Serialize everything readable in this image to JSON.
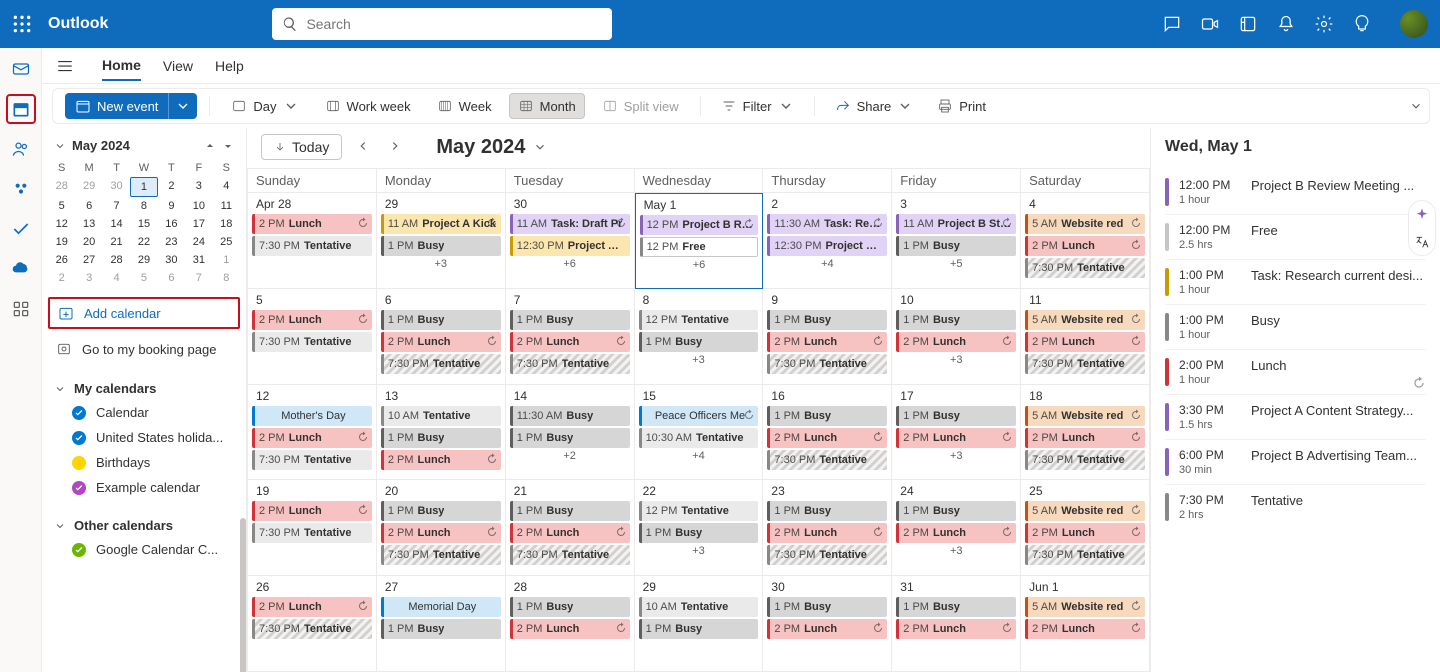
{
  "header": {
    "brand": "Outlook",
    "search_placeholder": "Search"
  },
  "rail": {
    "active": "calendar"
  },
  "menubar": {
    "home": "Home",
    "view": "View",
    "help": "Help"
  },
  "toolbar": {
    "new_event": "New event",
    "day": "Day",
    "work_week": "Work week",
    "week": "Week",
    "month": "Month",
    "split_view": "Split view",
    "filter": "Filter",
    "share": "Share",
    "print": "Print"
  },
  "mini": {
    "title": "May 2024",
    "dow": [
      "S",
      "M",
      "T",
      "W",
      "T",
      "F",
      "S"
    ],
    "cells": [
      {
        "n": "28",
        "o": true
      },
      {
        "n": "29",
        "o": true
      },
      {
        "n": "30",
        "o": true
      },
      {
        "n": "1",
        "today": true
      },
      {
        "n": "2"
      },
      {
        "n": "3"
      },
      {
        "n": "4"
      },
      {
        "n": "5"
      },
      {
        "n": "6"
      },
      {
        "n": "7"
      },
      {
        "n": "8"
      },
      {
        "n": "9"
      },
      {
        "n": "10"
      },
      {
        "n": "11"
      },
      {
        "n": "12"
      },
      {
        "n": "13"
      },
      {
        "n": "14"
      },
      {
        "n": "15"
      },
      {
        "n": "16"
      },
      {
        "n": "17"
      },
      {
        "n": "18"
      },
      {
        "n": "19"
      },
      {
        "n": "20"
      },
      {
        "n": "21"
      },
      {
        "n": "22"
      },
      {
        "n": "23"
      },
      {
        "n": "24"
      },
      {
        "n": "25"
      },
      {
        "n": "26"
      },
      {
        "n": "27"
      },
      {
        "n": "28"
      },
      {
        "n": "29"
      },
      {
        "n": "30"
      },
      {
        "n": "31"
      },
      {
        "n": "1",
        "o": true
      },
      {
        "n": "2",
        "o": true
      },
      {
        "n": "3",
        "o": true
      },
      {
        "n": "4",
        "o": true
      },
      {
        "n": "5",
        "o": true
      },
      {
        "n": "6",
        "o": true
      },
      {
        "n": "7",
        "o": true
      },
      {
        "n": "8",
        "o": true
      }
    ]
  },
  "links": {
    "add_calendar": "Add calendar",
    "booking": "Go to my booking page"
  },
  "groups": {
    "my": {
      "title": "My calendars",
      "items": [
        {
          "name": "Calendar",
          "color": "#0078d4",
          "check": true
        },
        {
          "name": "United States holida...",
          "color": "#0078d4",
          "check": true
        },
        {
          "name": "Birthdays",
          "color": "#ffd400",
          "check": false
        },
        {
          "name": "Example calendar",
          "color": "#b146c2",
          "check": true
        }
      ]
    },
    "other": {
      "title": "Other calendars",
      "items": [
        {
          "name": "Google Calendar C...",
          "color": "#6bb700",
          "check": true
        }
      ]
    }
  },
  "cal": {
    "today_btn": "Today",
    "title": "May 2024",
    "dow": [
      "Sunday",
      "Monday",
      "Tuesday",
      "Wednesday",
      "Thursday",
      "Friday",
      "Saturday"
    ],
    "days": [
      {
        "label": "Apr 28",
        "events": [
          {
            "c": "ev-lunch",
            "t": "2 PM",
            "s": "Lunch",
            "r": true
          },
          {
            "c": "ev-tent",
            "t": "7:30 PM",
            "s": "Tentative"
          }
        ]
      },
      {
        "label": "29",
        "events": [
          {
            "c": "ev-projA",
            "t": "11 AM",
            "s": "Project A Kick",
            "r": true
          },
          {
            "c": "ev-busy",
            "t": "1 PM",
            "s": "Busy"
          }
        ],
        "more": "+3"
      },
      {
        "label": "30",
        "events": [
          {
            "c": "ev-task",
            "t": "11 AM",
            "s": "Task: Draft Pr",
            "r": true
          },
          {
            "c": "ev-projB2",
            "t": "12:30 PM",
            "s": "Project A D"
          }
        ],
        "more": "+6"
      },
      {
        "label": "May 1",
        "today": true,
        "events": [
          {
            "c": "ev-projB",
            "t": "12 PM",
            "s": "Project B Revi",
            "r": true
          },
          {
            "c": "ev-free",
            "t": "12 PM",
            "s": "Free"
          }
        ],
        "more": "+6"
      },
      {
        "label": "2",
        "events": [
          {
            "c": "ev-task",
            "t": "11:30 AM",
            "s": "Task: Revie",
            "r": true
          },
          {
            "c": "ev-projB",
            "t": "12:30 PM",
            "s": "Project B Lo"
          }
        ],
        "more": "+4"
      },
      {
        "label": "3",
        "events": [
          {
            "c": "ev-task",
            "t": "11 AM",
            "s": "Project B Stak",
            "r": true
          },
          {
            "c": "ev-busy",
            "t": "1 PM",
            "s": "Busy"
          }
        ],
        "more": "+5"
      },
      {
        "label": "4",
        "events": [
          {
            "c": "ev-website",
            "t": "5 AM",
            "s": "Website red",
            "r": true
          },
          {
            "c": "ev-lunch-sat",
            "t": "2 PM",
            "s": "Lunch",
            "r": true
          },
          {
            "c": "ev-tent-hatch",
            "t": "7:30 PM",
            "s": "Tentative"
          }
        ]
      },
      {
        "label": "5",
        "events": [
          {
            "c": "ev-lunch",
            "t": "2 PM",
            "s": "Lunch",
            "r": true
          },
          {
            "c": "ev-tent",
            "t": "7:30 PM",
            "s": "Tentative"
          }
        ]
      },
      {
        "label": "6",
        "events": [
          {
            "c": "ev-busy",
            "t": "1 PM",
            "s": "Busy"
          },
          {
            "c": "ev-lunch",
            "t": "2 PM",
            "s": "Lunch",
            "r": true
          },
          {
            "c": "ev-tent-hatch",
            "t": "7:30 PM",
            "s": "Tentative"
          }
        ]
      },
      {
        "label": "7",
        "events": [
          {
            "c": "ev-busy",
            "t": "1 PM",
            "s": "Busy"
          },
          {
            "c": "ev-lunch",
            "t": "2 PM",
            "s": "Lunch",
            "r": true
          },
          {
            "c": "ev-tent-hatch",
            "t": "7:30 PM",
            "s": "Tentative"
          }
        ]
      },
      {
        "label": "8",
        "events": [
          {
            "c": "ev-tent",
            "t": "12 PM",
            "s": "Tentative"
          },
          {
            "c": "ev-busy",
            "t": "1 PM",
            "s": "Busy"
          }
        ],
        "more": "+3"
      },
      {
        "label": "9",
        "events": [
          {
            "c": "ev-busy",
            "t": "1 PM",
            "s": "Busy"
          },
          {
            "c": "ev-lunch",
            "t": "2 PM",
            "s": "Lunch",
            "r": true
          },
          {
            "c": "ev-tent-hatch",
            "t": "7:30 PM",
            "s": "Tentative"
          }
        ]
      },
      {
        "label": "10",
        "events": [
          {
            "c": "ev-busy",
            "t": "1 PM",
            "s": "Busy"
          },
          {
            "c": "ev-lunch",
            "t": "2 PM",
            "s": "Lunch",
            "r": true
          }
        ],
        "more": "+3"
      },
      {
        "label": "11",
        "events": [
          {
            "c": "ev-website",
            "t": "5 AM",
            "s": "Website red",
            "r": true
          },
          {
            "c": "ev-lunch-sat",
            "t": "2 PM",
            "s": "Lunch",
            "r": true
          },
          {
            "c": "ev-tent-hatch",
            "t": "7:30 PM",
            "s": "Tentative"
          }
        ]
      },
      {
        "label": "12",
        "events": [
          {
            "c": "ev-holiday",
            "s": "Mother's Day"
          },
          {
            "c": "ev-lunch",
            "t": "2 PM",
            "s": "Lunch",
            "r": true
          },
          {
            "c": "ev-tent",
            "t": "7:30 PM",
            "s": "Tentative"
          }
        ]
      },
      {
        "label": "13",
        "events": [
          {
            "c": "ev-tent",
            "t": "10 AM",
            "s": "Tentative"
          },
          {
            "c": "ev-busy",
            "t": "1 PM",
            "s": "Busy"
          },
          {
            "c": "ev-lunch",
            "t": "2 PM",
            "s": "Lunch",
            "r": true
          }
        ]
      },
      {
        "label": "14",
        "events": [
          {
            "c": "ev-busy",
            "t": "11:30 AM",
            "s": "Busy"
          },
          {
            "c": "ev-busy",
            "t": "1 PM",
            "s": "Busy"
          }
        ],
        "more": "+2"
      },
      {
        "label": "15",
        "events": [
          {
            "c": "ev-holiday",
            "s": "Peace Officers Me",
            "r": true
          },
          {
            "c": "ev-tent",
            "t": "10:30 AM",
            "s": "Tentative"
          }
        ],
        "more": "+4"
      },
      {
        "label": "16",
        "events": [
          {
            "c": "ev-busy",
            "t": "1 PM",
            "s": "Busy"
          },
          {
            "c": "ev-lunch",
            "t": "2 PM",
            "s": "Lunch",
            "r": true
          },
          {
            "c": "ev-tent-hatch",
            "t": "7:30 PM",
            "s": "Tentative"
          }
        ]
      },
      {
        "label": "17",
        "events": [
          {
            "c": "ev-busy",
            "t": "1 PM",
            "s": "Busy"
          },
          {
            "c": "ev-lunch",
            "t": "2 PM",
            "s": "Lunch",
            "r": true
          }
        ],
        "more": "+3"
      },
      {
        "label": "18",
        "events": [
          {
            "c": "ev-website",
            "t": "5 AM",
            "s": "Website red",
            "r": true
          },
          {
            "c": "ev-lunch-sat",
            "t": "2 PM",
            "s": "Lunch",
            "r": true
          },
          {
            "c": "ev-tent-hatch",
            "t": "7:30 PM",
            "s": "Tentative"
          }
        ]
      },
      {
        "label": "19",
        "events": [
          {
            "c": "ev-lunch",
            "t": "2 PM",
            "s": "Lunch",
            "r": true
          },
          {
            "c": "ev-tent",
            "t": "7:30 PM",
            "s": "Tentative"
          }
        ]
      },
      {
        "label": "20",
        "events": [
          {
            "c": "ev-busy",
            "t": "1 PM",
            "s": "Busy"
          },
          {
            "c": "ev-lunch",
            "t": "2 PM",
            "s": "Lunch",
            "r": true
          },
          {
            "c": "ev-tent-hatch",
            "t": "7:30 PM",
            "s": "Tentative"
          }
        ]
      },
      {
        "label": "21",
        "events": [
          {
            "c": "ev-busy",
            "t": "1 PM",
            "s": "Busy"
          },
          {
            "c": "ev-lunch",
            "t": "2 PM",
            "s": "Lunch",
            "r": true
          },
          {
            "c": "ev-tent-hatch",
            "t": "7:30 PM",
            "s": "Tentative"
          }
        ]
      },
      {
        "label": "22",
        "events": [
          {
            "c": "ev-tent",
            "t": "12 PM",
            "s": "Tentative"
          },
          {
            "c": "ev-busy",
            "t": "1 PM",
            "s": "Busy"
          }
        ],
        "more": "+3"
      },
      {
        "label": "23",
        "events": [
          {
            "c": "ev-busy",
            "t": "1 PM",
            "s": "Busy"
          },
          {
            "c": "ev-lunch",
            "t": "2 PM",
            "s": "Lunch",
            "r": true
          },
          {
            "c": "ev-tent-hatch",
            "t": "7:30 PM",
            "s": "Tentative"
          }
        ]
      },
      {
        "label": "24",
        "events": [
          {
            "c": "ev-busy",
            "t": "1 PM",
            "s": "Busy"
          },
          {
            "c": "ev-lunch",
            "t": "2 PM",
            "s": "Lunch",
            "r": true
          }
        ],
        "more": "+3"
      },
      {
        "label": "25",
        "events": [
          {
            "c": "ev-website",
            "t": "5 AM",
            "s": "Website red",
            "r": true
          },
          {
            "c": "ev-lunch-sat",
            "t": "2 PM",
            "s": "Lunch",
            "r": true
          },
          {
            "c": "ev-tent-hatch",
            "t": "7:30 PM",
            "s": "Tentative"
          }
        ]
      },
      {
        "label": "26",
        "events": [
          {
            "c": "ev-lunch",
            "t": "2 PM",
            "s": "Lunch",
            "r": true
          },
          {
            "c": "ev-tent-hatch",
            "t": "7:30 PM",
            "s": "Tentative"
          }
        ]
      },
      {
        "label": "27",
        "events": [
          {
            "c": "ev-holiday",
            "s": "Memorial Day"
          },
          {
            "c": "ev-busy",
            "t": "1 PM",
            "s": "Busy"
          }
        ]
      },
      {
        "label": "28",
        "events": [
          {
            "c": "ev-busy",
            "t": "1 PM",
            "s": "Busy"
          },
          {
            "c": "ev-lunch",
            "t": "2 PM",
            "s": "Lunch",
            "r": true
          }
        ]
      },
      {
        "label": "29",
        "events": [
          {
            "c": "ev-tent",
            "t": "10 AM",
            "s": "Tentative"
          },
          {
            "c": "ev-busy",
            "t": "1 PM",
            "s": "Busy"
          }
        ]
      },
      {
        "label": "30",
        "events": [
          {
            "c": "ev-busy",
            "t": "1 PM",
            "s": "Busy"
          },
          {
            "c": "ev-lunch",
            "t": "2 PM",
            "s": "Lunch",
            "r": true
          }
        ]
      },
      {
        "label": "31",
        "events": [
          {
            "c": "ev-busy",
            "t": "1 PM",
            "s": "Busy"
          },
          {
            "c": "ev-lunch",
            "t": "2 PM",
            "s": "Lunch",
            "r": true
          }
        ]
      },
      {
        "label": "Jun 1",
        "events": [
          {
            "c": "ev-website",
            "t": "5 AM",
            "s": "Website red",
            "r": true
          },
          {
            "c": "ev-lunch-sat",
            "t": "2 PM",
            "s": "Lunch",
            "r": true
          }
        ]
      }
    ]
  },
  "agenda": {
    "title": "Wed, May 1",
    "items": [
      {
        "color": "#8764b8",
        "t1": "12:00 PM",
        "t2": "1 hour",
        "s": "Project B Review Meeting ..."
      },
      {
        "color": "#c8c6c4",
        "t1": "12:00 PM",
        "t2": "2.5 hrs",
        "s": "Free"
      },
      {
        "color": "#ca9b00",
        "t1": "1:00 PM",
        "t2": "1 hour",
        "s": "Task: Research current desi..."
      },
      {
        "color": "#8a8886",
        "t1": "1:00 PM",
        "t2": "1 hour",
        "s": "Busy"
      },
      {
        "color": "#d13438",
        "t1": "2:00 PM",
        "t2": "1 hour",
        "s": "Lunch",
        "r": true
      },
      {
        "color": "#8764b8",
        "t1": "3:30 PM",
        "t2": "1.5 hrs",
        "s": "Project A Content Strategy..."
      },
      {
        "color": "#8764b8",
        "t1": "6:00 PM",
        "t2": "30 min",
        "s": "Project B Advertising Team..."
      },
      {
        "color": "#8a8886",
        "t1": "7:30 PM",
        "t2": "2 hrs",
        "s": "Tentative"
      }
    ]
  }
}
